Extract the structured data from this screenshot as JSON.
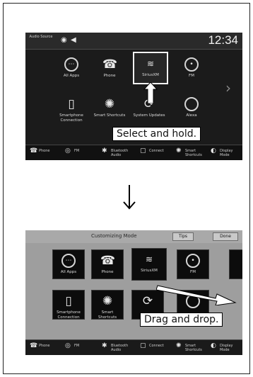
{
  "top": {
    "status": {
      "audio_source": "Audio Source",
      "time": "12:34"
    },
    "apps": [
      {
        "label": "All Apps",
        "icon": "grid-icon"
      },
      {
        "label": "Phone",
        "icon": "phone-icon"
      },
      {
        "label": "SiriusXM",
        "icon": "siriusxm-icon"
      },
      {
        "label": "FM",
        "icon": "fm-icon"
      },
      {
        "label": "Smartphone Connection",
        "icon": "smartphone-icon"
      },
      {
        "label": "Smart Shortcuts",
        "icon": "shortcut-icon"
      },
      {
        "label": "System Updates",
        "icon": "update-icon"
      },
      {
        "label": "Alexa",
        "icon": "alexa-icon"
      }
    ],
    "callout": "Select and hold."
  },
  "dock": [
    {
      "label": "Phone",
      "icon": "phone-icon"
    },
    {
      "label": "FM",
      "icon": "fm-icon"
    },
    {
      "label": "Bluetooth Audio",
      "icon": "bluetooth-icon"
    },
    {
      "label": "Connect",
      "icon": "connect-icon"
    },
    {
      "label": "Smart Shortcuts",
      "icon": "shortcut-icon"
    },
    {
      "label": "Display Mode",
      "icon": "display-mode-icon"
    }
  ],
  "bottom": {
    "title": "Customizing Mode",
    "tips_label": "Tips",
    "done_label": "Done",
    "apps": [
      {
        "label": "All Apps",
        "icon": "grid-icon"
      },
      {
        "label": "Phone",
        "icon": "phone-icon"
      },
      {
        "label": "SiriusXM",
        "icon": "siriusxm-icon"
      },
      {
        "label": "FM",
        "icon": "fm-icon"
      },
      {
        "label": "Smartphone Connection",
        "icon": "smartphone-icon"
      },
      {
        "label": "Smart Shortcuts",
        "icon": "shortcut-icon"
      },
      {
        "label": "",
        "icon": "update-icon"
      },
      {
        "label": "",
        "icon": "alexa-icon"
      }
    ],
    "callout": "Drag and drop."
  }
}
